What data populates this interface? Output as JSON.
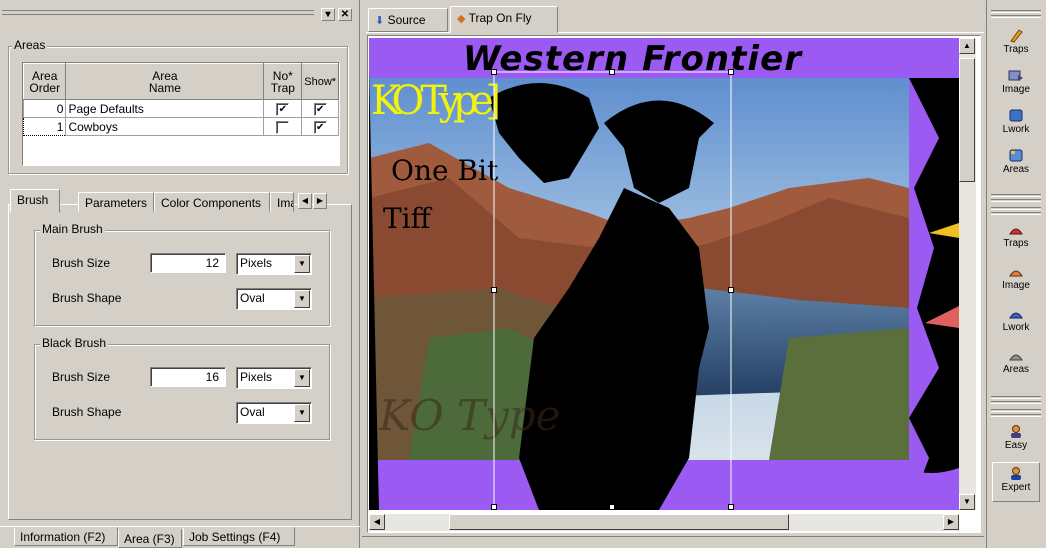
{
  "left_panel": {
    "areas_group_title": "Areas",
    "areas_table": {
      "headers": [
        [
          "Area",
          "Order"
        ],
        [
          "Area",
          "Name"
        ],
        [
          "No*",
          "Trap"
        ],
        [
          "Show*"
        ]
      ],
      "rows": [
        {
          "order": "0",
          "name": "Page Defaults",
          "no_trap": true,
          "show": true
        },
        {
          "order": "1",
          "name": "Cowboys",
          "no_trap": false,
          "show": true
        }
      ]
    },
    "tabs": [
      "Brush",
      "Parameters",
      "Color Components",
      "Ima"
    ],
    "active_tab": "Brush",
    "main_brush": {
      "title": "Main Brush",
      "size_label": "Brush Size",
      "size_value": "12",
      "size_unit": "Pixels",
      "shape_label": "Brush Shape",
      "shape_value": "Oval"
    },
    "black_brush": {
      "title": "Black Brush",
      "size_label": "Brush Size",
      "size_value": "16",
      "size_unit": "Pixels",
      "shape_label": "Brush Shape",
      "shape_value": "Oval"
    },
    "bottom_tabs": [
      "Information (F2)",
      "Area (F3)",
      "Job Settings (F4)"
    ],
    "active_bottom_tab": "Area (F3)"
  },
  "main": {
    "tabs": [
      "Source",
      "Trap On Fly"
    ],
    "active_tab": "Trap On Fly",
    "image_texts": {
      "title": "Western Frontier",
      "ko_type": "KO Type]",
      "one_bit": "One Bit",
      "tiff": "Tiff",
      "faint": "KO Type"
    }
  },
  "toolbar": {
    "group1": [
      {
        "label": "Traps",
        "icon": "pencil-icon"
      },
      {
        "label": "Image",
        "icon": "image-arrow-icon"
      },
      {
        "label": "Lwork",
        "icon": "lwork-icon"
      },
      {
        "label": "Areas",
        "icon": "areas-icon"
      }
    ],
    "group2": [
      {
        "label": "Traps",
        "icon": "red-traps-icon"
      },
      {
        "label": "Image",
        "icon": "orange-image-icon"
      },
      {
        "label": "Lwork",
        "icon": "blue-lwork-icon"
      },
      {
        "label": "Areas",
        "icon": "grey-areas-icon"
      }
    ],
    "group3": [
      {
        "label": "Easy",
        "icon": "easy-user-icon"
      },
      {
        "label": "Expert",
        "icon": "expert-user-icon"
      }
    ]
  },
  "colors": {
    "canvas_bg": "#9b5bf3",
    "title_yellow": "#f2f20a"
  }
}
